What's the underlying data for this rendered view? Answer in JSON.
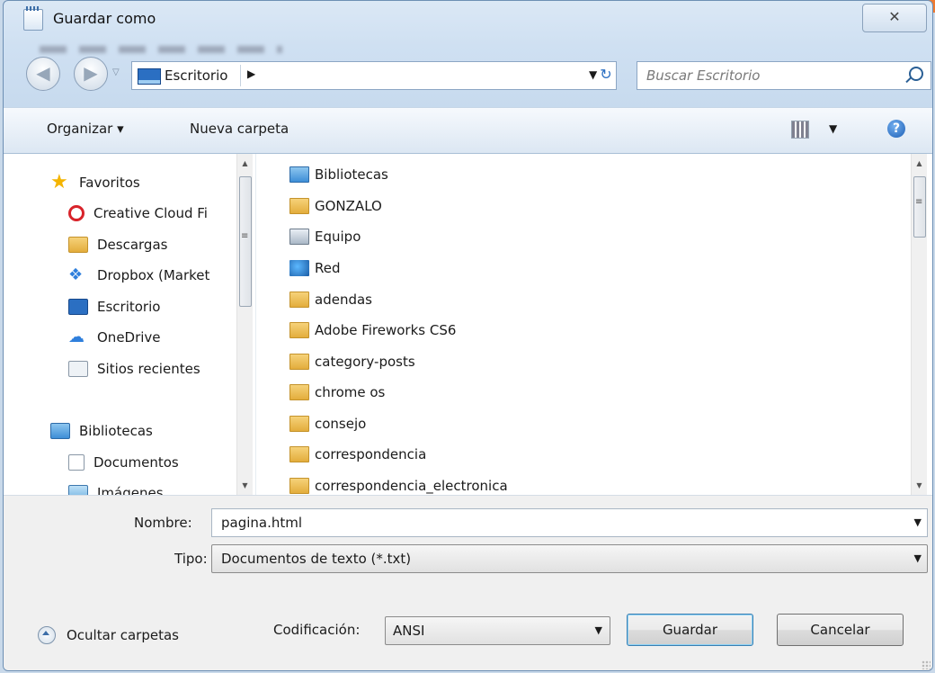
{
  "window": {
    "title": "Guardar como",
    "close_glyph": "✕"
  },
  "nav_buttons": {
    "back": "◀",
    "forward": "▶",
    "history": "▽"
  },
  "address": {
    "location": "Escritorio",
    "separator": "▶",
    "dropdown": "▼",
    "refresh": "↻"
  },
  "search": {
    "placeholder": "Buscar Escritorio"
  },
  "toolbar": {
    "organize_label": "Organizar ▾",
    "new_folder_label": "Nueva carpeta",
    "view_dropdown": "▼",
    "help": "?"
  },
  "nav_pane": {
    "items": [
      {
        "label": "Favoritos",
        "icon": "star-icon"
      },
      {
        "label": "Creative Cloud Fi",
        "icon": "creative-cloud-icon"
      },
      {
        "label": "Descargas",
        "icon": "downloads-icon"
      },
      {
        "label": "Dropbox (Market",
        "icon": "dropbox-icon"
      },
      {
        "label": "Escritorio",
        "icon": "desktop-icon"
      },
      {
        "label": "OneDrive",
        "icon": "onedrive-icon"
      },
      {
        "label": "Sitios recientes",
        "icon": "recent-places-icon"
      },
      {
        "label": "Bibliotecas",
        "icon": "libraries-icon"
      },
      {
        "label": "Documentos",
        "icon": "documents-icon"
      },
      {
        "label": "Imágenes",
        "icon": "pictures-icon"
      }
    ]
  },
  "file_pane": {
    "items": [
      {
        "label": "Bibliotecas",
        "icon": "libraries-icon"
      },
      {
        "label": "GONZALO",
        "icon": "user-folder-icon"
      },
      {
        "label": "Equipo",
        "icon": "computer-icon"
      },
      {
        "label": "Red",
        "icon": "network-icon"
      },
      {
        "label": "adendas",
        "icon": "folder-icon"
      },
      {
        "label": "Adobe Fireworks CS6",
        "icon": "folder-icon"
      },
      {
        "label": "category-posts",
        "icon": "folder-icon"
      },
      {
        "label": "chrome os",
        "icon": "folder-icon"
      },
      {
        "label": "consejo",
        "icon": "folder-icon"
      },
      {
        "label": "correspondencia",
        "icon": "folder-icon"
      },
      {
        "label": "correspondencia_electronica",
        "icon": "folder-icon"
      }
    ]
  },
  "form": {
    "name_label": "Nombre:",
    "name_value": "pagina.html",
    "type_label": "Tipo:",
    "type_value": "Documentos de texto (*.txt)",
    "encoding_label": "Codificación:",
    "encoding_value": "ANSI",
    "dropdown_glyph": "▼"
  },
  "footer": {
    "hide_folders_label": "Ocultar carpetas",
    "save_label": "Guardar",
    "cancel_label": "Cancelar"
  }
}
